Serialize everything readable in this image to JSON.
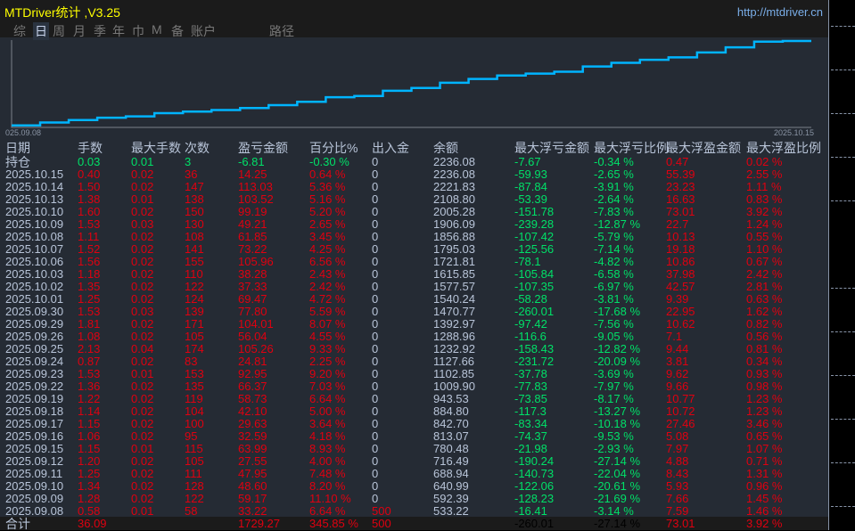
{
  "header": {
    "title": "MTDriver统计 ,V3.25",
    "link": "http://mtdriver.cn",
    "tabs": [
      "综",
      "日",
      "周",
      "月",
      "季",
      "年",
      "巾",
      "M",
      "备",
      "账户",
      "路径"
    ],
    "active_tab": "日"
  },
  "chart": {
    "start_label": "025.09.08",
    "end_label": "2025.10.15",
    "line_color": "#00b4ff"
  },
  "columns": [
    "日期",
    "手数",
    "最大手数",
    "次数",
    "盈亏金额",
    "百分比%",
    "出入金",
    "余额",
    "最大浮亏金额",
    "最大浮亏比例",
    "最大浮盈金额",
    "最大浮盈比例"
  ],
  "holding": [
    "持仓",
    "0.03",
    "0.01",
    "3",
    "-6.81",
    "-0.30 %",
    "0",
    "2236.08",
    "-7.67",
    "-0.34 %",
    "0.47",
    "0.02 %"
  ],
  "rows": [
    [
      "2025.10.15",
      "0.40",
      "0.02",
      "36",
      "14.25",
      "0.64 %",
      "0",
      "2236.08",
      "-59.93",
      "-2.65 %",
      "55.39",
      "2.55 %"
    ],
    [
      "2025.10.14",
      "1.50",
      "0.02",
      "147",
      "113.03",
      "5.36 %",
      "0",
      "2221.83",
      "-87.84",
      "-3.91 %",
      "23.23",
      "1.11 %"
    ],
    [
      "2025.10.13",
      "1.38",
      "0.01",
      "138",
      "103.52",
      "5.16 %",
      "0",
      "2108.80",
      "-53.39",
      "-2.64 %",
      "16.63",
      "0.83 %"
    ],
    [
      "2025.10.10",
      "1.60",
      "0.02",
      "150",
      "99.19",
      "5.20 %",
      "0",
      "2005.28",
      "-151.78",
      "-7.83 %",
      "73.01",
      "3.92 %"
    ],
    [
      "2025.10.09",
      "1.53",
      "0.03",
      "130",
      "49.21",
      "2.65 %",
      "0",
      "1906.09",
      "-239.28",
      "-12.87 %",
      "22.7",
      "1.24 %"
    ],
    [
      "2025.10.08",
      "1.11",
      "0.02",
      "108",
      "61.85",
      "3.45 %",
      "0",
      "1856.88",
      "-107.42",
      "-5.79 %",
      "10.13",
      "0.55 %"
    ],
    [
      "2025.10.07",
      "1.52",
      "0.02",
      "141",
      "73.22",
      "4.25 %",
      "0",
      "1795.03",
      "-125.56",
      "-7.14 %",
      "19.18",
      "1.10 %"
    ],
    [
      "2025.10.06",
      "1.56",
      "0.02",
      "155",
      "105.96",
      "6.56 %",
      "0",
      "1721.81",
      "-78.1",
      "-4.82 %",
      "10.86",
      "0.67 %"
    ],
    [
      "2025.10.03",
      "1.18",
      "0.02",
      "110",
      "38.28",
      "2.43 %",
      "0",
      "1615.85",
      "-105.84",
      "-6.58 %",
      "37.98",
      "2.42 %"
    ],
    [
      "2025.10.02",
      "1.35",
      "0.02",
      "122",
      "37.33",
      "2.42 %",
      "0",
      "1577.57",
      "-107.35",
      "-6.97 %",
      "42.57",
      "2.81 %"
    ],
    [
      "2025.10.01",
      "1.25",
      "0.02",
      "124",
      "69.47",
      "4.72 %",
      "0",
      "1540.24",
      "-58.28",
      "-3.81 %",
      "9.39",
      "0.63 %"
    ],
    [
      "2025.09.30",
      "1.53",
      "0.03",
      "139",
      "77.80",
      "5.59 %",
      "0",
      "1470.77",
      "-260.01",
      "-17.68 %",
      "22.95",
      "1.62 %"
    ],
    [
      "2025.09.29",
      "1.81",
      "0.02",
      "171",
      "104.01",
      "8.07 %",
      "0",
      "1392.97",
      "-97.42",
      "-7.56 %",
      "10.62",
      "0.82 %"
    ],
    [
      "2025.09.26",
      "1.08",
      "0.02",
      "105",
      "56.04",
      "4.55 %",
      "0",
      "1288.96",
      "-116.6",
      "-9.05 %",
      "7.1",
      "0.56 %"
    ],
    [
      "2025.09.25",
      "2.13",
      "0.04",
      "174",
      "105.26",
      "9.33 %",
      "0",
      "1232.92",
      "-158.43",
      "-12.82 %",
      "9.44",
      "0.81 %"
    ],
    [
      "2025.09.24",
      "0.87",
      "0.02",
      "83",
      "24.81",
      "2.25 %",
      "0",
      "1127.66",
      "-231.72",
      "-20.09 %",
      "3.81",
      "0.34 %"
    ],
    [
      "2025.09.23",
      "1.53",
      "0.01",
      "153",
      "92.95",
      "9.20 %",
      "0",
      "1102.85",
      "-37.78",
      "-3.69 %",
      "9.62",
      "0.93 %"
    ],
    [
      "2025.09.22",
      "1.36",
      "0.02",
      "135",
      "66.37",
      "7.03 %",
      "0",
      "1009.90",
      "-77.83",
      "-7.97 %",
      "9.66",
      "0.98 %"
    ],
    [
      "2025.09.19",
      "1.22",
      "0.02",
      "119",
      "58.73",
      "6.64 %",
      "0",
      "943.53",
      "-73.85",
      "-8.17 %",
      "10.77",
      "1.23 %"
    ],
    [
      "2025.09.18",
      "1.14",
      "0.02",
      "104",
      "42.10",
      "5.00 %",
      "0",
      "884.80",
      "-117.3",
      "-13.27 %",
      "10.72",
      "1.23 %"
    ],
    [
      "2025.09.17",
      "1.15",
      "0.02",
      "100",
      "29.63",
      "3.64 %",
      "0",
      "842.70",
      "-83.34",
      "-10.18 %",
      "27.46",
      "3.46 %"
    ],
    [
      "2025.09.16",
      "1.06",
      "0.02",
      "95",
      "32.59",
      "4.18 %",
      "0",
      "813.07",
      "-74.37",
      "-9.53 %",
      "5.08",
      "0.65 %"
    ],
    [
      "2025.09.15",
      "1.15",
      "0.01",
      "115",
      "63.99",
      "8.93 %",
      "0",
      "780.48",
      "-21.98",
      "-2.93 %",
      "7.97",
      "1.07 %"
    ],
    [
      "2025.09.12",
      "1.20",
      "0.02",
      "105",
      "27.55",
      "4.00 %",
      "0",
      "716.49",
      "-190.24",
      "-27.14 %",
      "4.88",
      "0.71 %"
    ],
    [
      "2025.09.11",
      "1.25",
      "0.02",
      "111",
      "47.95",
      "7.48 %",
      "0",
      "688.94",
      "-140.73",
      "-22.04 %",
      "8.43",
      "1.31 %"
    ],
    [
      "2025.09.10",
      "1.34",
      "0.02",
      "128",
      "48.60",
      "8.20 %",
      "0",
      "640.99",
      "-122.06",
      "-20.61 %",
      "5.93",
      "0.96 %"
    ],
    [
      "2025.09.09",
      "1.28",
      "0.02",
      "122",
      "59.17",
      "11.10 %",
      "0",
      "592.39",
      "-128.23",
      "-21.69 %",
      "7.66",
      "1.45 %"
    ],
    [
      "2025.09.08",
      "0.58",
      "0.01",
      "58",
      "33.22",
      "6.64 %",
      "500",
      "533.22",
      "-16.41",
      "-3.14 %",
      "7.59",
      "1.46 %"
    ]
  ],
  "total": [
    "合计",
    "36.09",
    "",
    "",
    "1729.27",
    "345.85 %",
    "500",
    "",
    "-260.01",
    "-27.14 %",
    "73.01",
    "3.92 %"
  ]
}
